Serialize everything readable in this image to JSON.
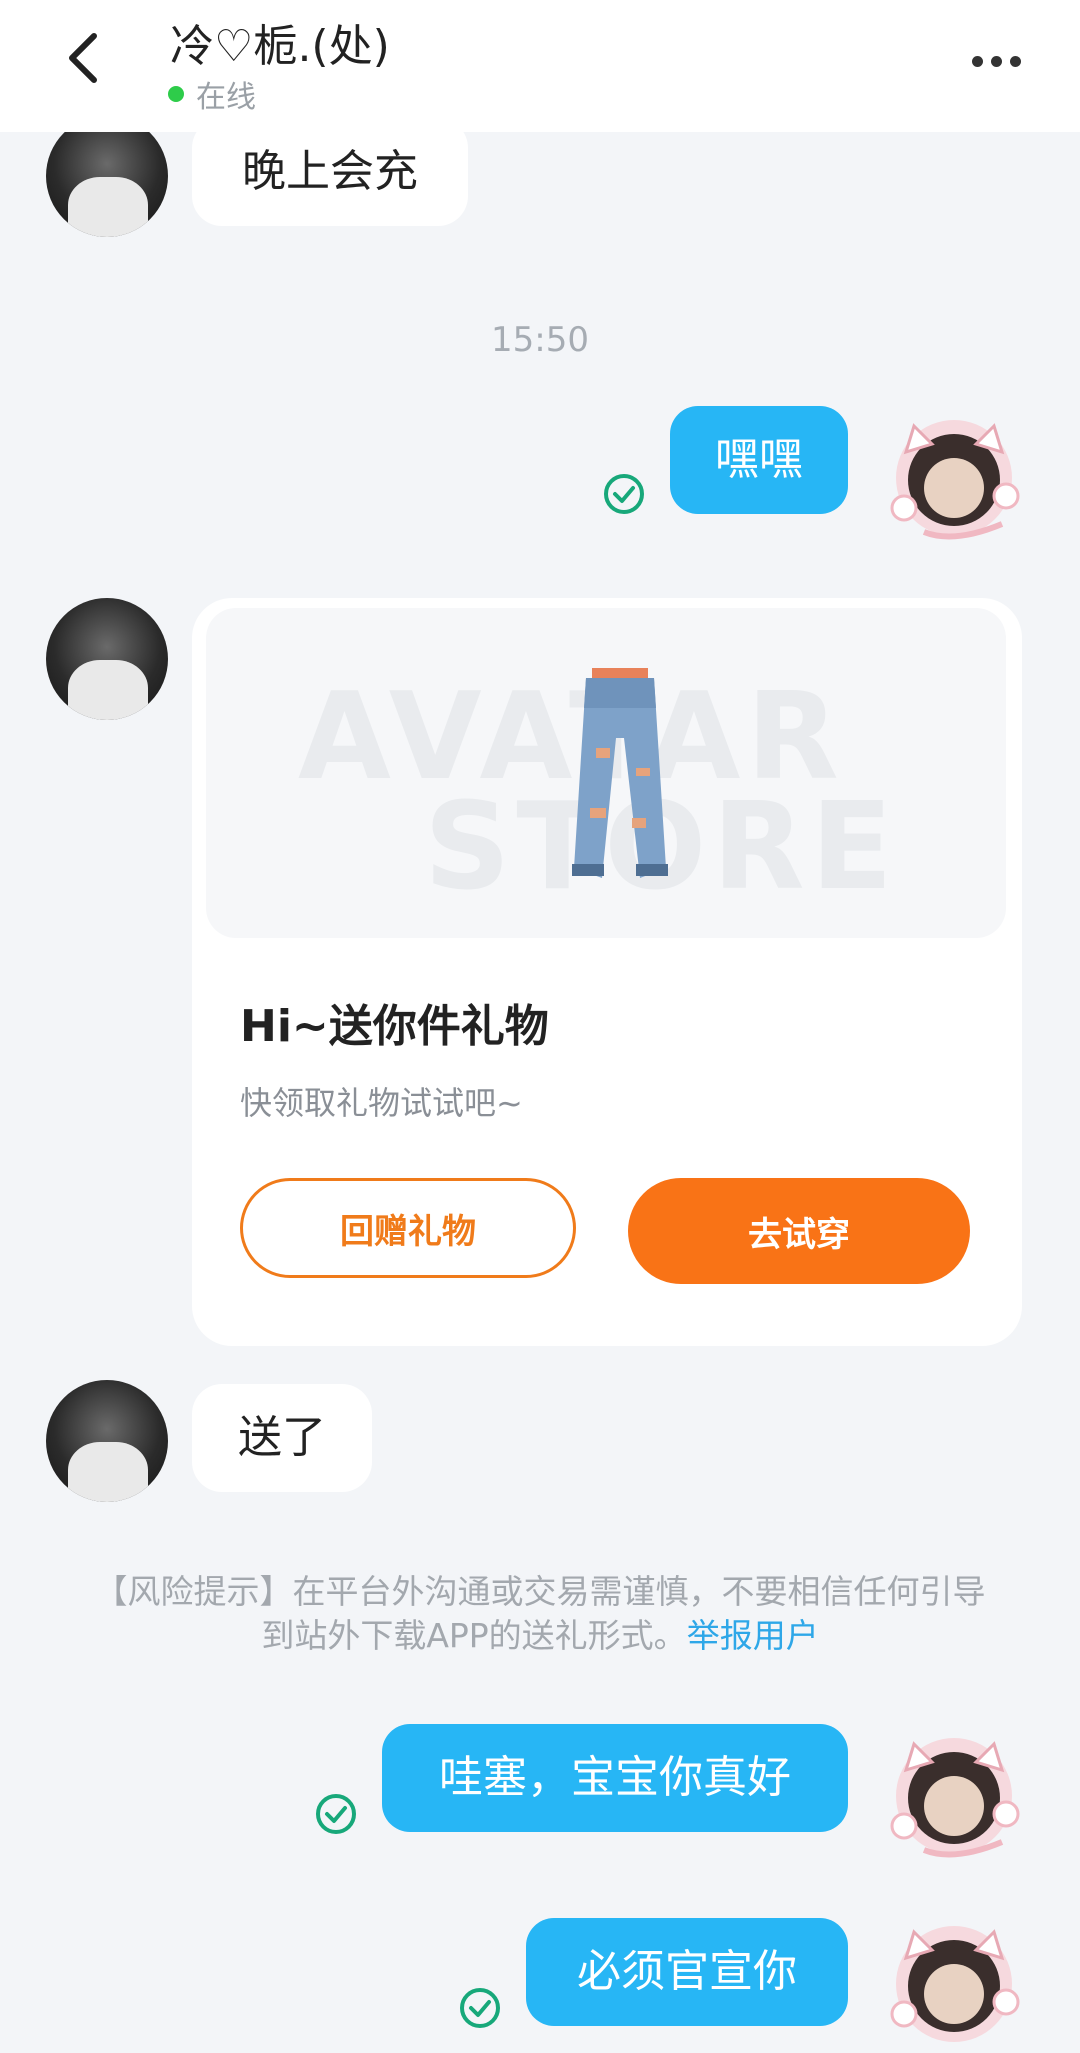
{
  "header": {
    "title": "冷♡栀.(处)",
    "status": "在线"
  },
  "messages": {
    "m1": "晚上会充",
    "time1": "15:50",
    "m2": "嘿嘿",
    "m4": "送了",
    "m5": "哇塞，宝宝你真好",
    "m6": "必须官宣你"
  },
  "gift_card": {
    "watermark_line1": "AVATAR",
    "watermark_line2": "STORE",
    "title": "Hi~送你件礼物",
    "subtitle": "快领取礼物试试吧~",
    "return_label": "回赠礼物",
    "try_label": "去试穿"
  },
  "risk_notice": {
    "text": "【风险提示】在平台外沟通或交易需谨慎，不要相信任何引导到站外下载APP的送礼形式。",
    "link": "举报用户"
  },
  "colors": {
    "outgoing_bubble": "#27b6f5",
    "primary_orange": "#f97316",
    "online_dot": "#2ecc4a",
    "check_green": "#17a87a",
    "report_link": "#2ea7e8"
  }
}
